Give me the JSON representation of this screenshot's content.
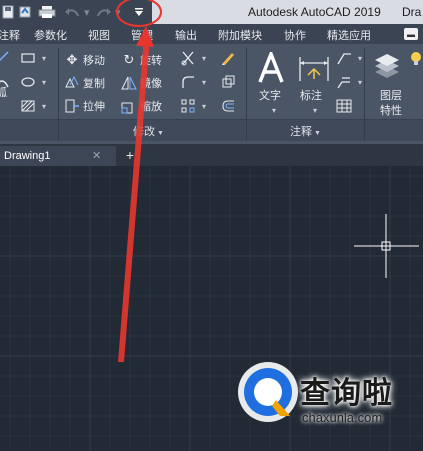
{
  "app": {
    "title": "Autodesk AutoCAD 2019",
    "doc_title": "Dra"
  },
  "quick_access": {
    "icons": [
      "save-icon",
      "export-icon",
      "print-icon",
      "undo-icon",
      "redo-icon",
      "customize-dropdown-icon"
    ]
  },
  "menu": {
    "tabs": [
      "注释",
      "参数化",
      "视图",
      "管理",
      "输出",
      "附加模块",
      "协作",
      "精选应用"
    ]
  },
  "ribbon": {
    "modify": {
      "label": "修改",
      "tools": [
        "移动",
        "旋转",
        "复制",
        "镜像",
        "拉伸",
        "缩放"
      ]
    },
    "annotation": {
      "label": "注释",
      "text": "文字",
      "dimension": "标注"
    },
    "layers": {
      "label_line1": "图层",
      "label_line2": "特性"
    }
  },
  "document_tabs": {
    "active": "Drawing1",
    "close_glyph": "✕",
    "new_glyph": "+"
  },
  "watermark": {
    "text": "查询啦",
    "url": "chaxunla.com"
  },
  "colors": {
    "canvas": "#222a35",
    "ribbon": "#4a5565",
    "annotation_red": "#e8362f"
  }
}
